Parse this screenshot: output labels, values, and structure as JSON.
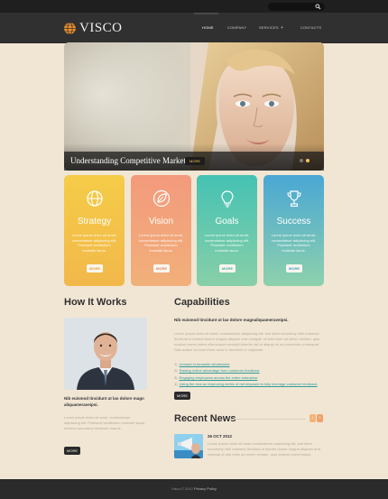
{
  "topbar": {
    "search_placeholder": ""
  },
  "header": {
    "logo": "VISCO",
    "nav": [
      {
        "label": "HOME"
      },
      {
        "label": "COMPANY"
      },
      {
        "label": "SERVICES"
      },
      {
        "label": "CONTACTS"
      }
    ],
    "services_arrow": "+"
  },
  "hero": {
    "caption": "Understanding Competitive Markets",
    "more_label": "MORE"
  },
  "cards": [
    {
      "title": "Strategy",
      "text": "Lorem ipsum dolor sit amet, consectetuer adipiscing elit. Praesent vestibulum molestie lacus.",
      "more_label": "MORE",
      "icon": "globe-icon"
    },
    {
      "title": "Vision",
      "text": "Lorem ipsum dolor sit amet, consectetuer adipiscing elit. Praesent vestibulum molestie lacus.",
      "more_label": "MORE",
      "icon": "leaf-icon"
    },
    {
      "title": "Goals",
      "text": "Lorem ipsum dolor sit amet, consectetuer adipiscing elit. Praesent vestibulum molestie lacus.",
      "more_label": "MORE",
      "icon": "lightbulb-icon"
    },
    {
      "title": "Success",
      "text": "Lorem ipsum dolor sit amet, consectetuer adipiscing elit. Praesent vestibulum molestie lacus.",
      "more_label": "MORE",
      "icon": "trophy-icon"
    }
  ],
  "how_it_works": {
    "title": "How It Works",
    "subtitle": "Nib euismod tincidunt ut lao dolore magn aliquameraveipsi.",
    "text": "Lorem ipsum dolor sit amet, consectetuer adipiscing elit. Praesent vestibulum molestie lacus. Aenean nonummy hendrerit mauris.",
    "more_label": "MORE"
  },
  "capabilities": {
    "title": "Capabilities",
    "subtitle": "Nib euismod tincidunt ut lao dolore magnaliquameraveipsi.",
    "text": "Lorem ipsum dolor sit amet, consectetuer adipiscing elit, sed diam nonummy nibh euismod tincidunt ut laoreet dolore magna aliquam erat volutpat. Ut wisi enim ad minim veniam, quis nostrud exerci tation ullamcorper suscipit lobortis nisl ut aliquip ex ea commodo consequat. Duis autem vel eum iriure dolor in hendrerit in vulputate.",
    "list": [
      {
        "num": "1)",
        "text": "Unmark in forwards wholesome"
      },
      {
        "num": "2)",
        "text": "Raising online advantage from customer feedback"
      },
      {
        "num": "3)",
        "text": "Engaging employees across the entire enterprise"
      },
      {
        "num": "4)",
        "text": "Using the new an improving metric of net deposed to fully leverage customer feedback"
      }
    ],
    "more_label": "MORE"
  },
  "recent_news": {
    "title": "Recent News",
    "prev": "‹",
    "next": "›",
    "date": "26 OCT 2012",
    "text": "Lorem ipsum dolor sit amet consectetuer adipiscing elit, sed diam nonummy nibh euismod tincidunt ut laoreet dolore magna aliquam erat volutpat ut wisi enim ad minim veniam, quis nostrud exerci tation."
  },
  "footer": {
    "copyright": "Visco © 2012",
    "link": "Privacy Policy"
  },
  "colors": {
    "background": "#f1e6d4",
    "header": "#303030",
    "strategy": "#f5cc48",
    "vision": "#f39a7c",
    "goals": "#45c2b3",
    "success": "#4aa7d4",
    "accent_more": "#eec54e"
  }
}
